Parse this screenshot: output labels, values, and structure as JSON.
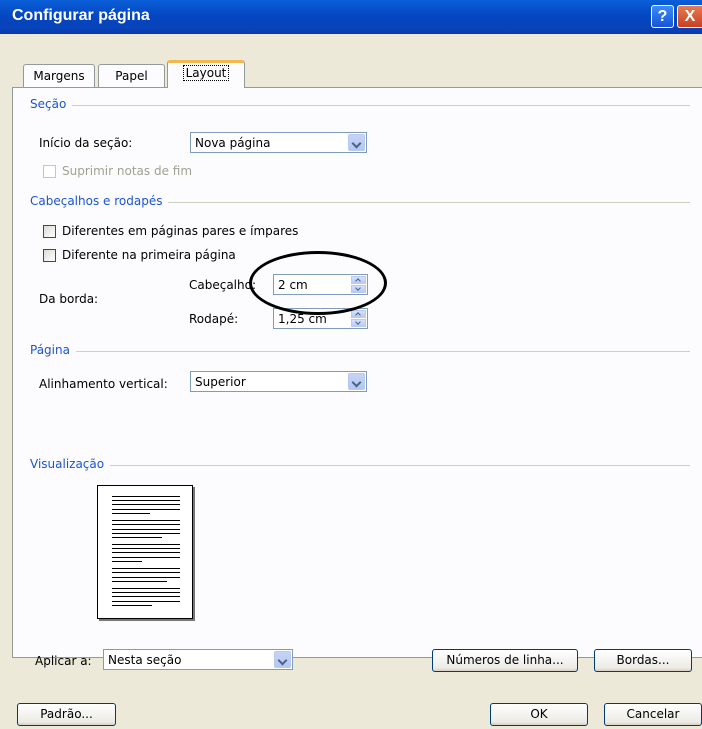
{
  "window": {
    "title": "Configurar página"
  },
  "titlebar": {
    "help": "?",
    "close": "X"
  },
  "tabs": [
    "Margens",
    "Papel",
    "Layout"
  ],
  "secao": {
    "heading": "Seção",
    "inicio_label": "Início da seção:",
    "inicio_value": "Nova página",
    "suprimir_label": "Suprimir notas de fim"
  },
  "cabecalhos": {
    "heading": "Cabeçalhos e rodapés",
    "pares_impares": "Diferentes em páginas pares e ímpares",
    "primeira_pagina": "Diferente na primeira página",
    "da_borda": "Da borda:",
    "cabecalho_label": "Cabeçalho:",
    "cabecalho_value": "2 cm",
    "rodape_label": "Rodapé:",
    "rodape_value": "1,25 cm"
  },
  "pagina": {
    "heading": "Página",
    "alinhamento_label": "Alinhamento vertical:",
    "alinhamento_value": "Superior"
  },
  "visualizacao": {
    "heading": "Visualização"
  },
  "aplicar": {
    "label": "Aplicar a:",
    "value": "Nesta seção"
  },
  "buttons": {
    "numeros": "Números de linha...",
    "bordas": "Bordas...",
    "padrao": "Padrão...",
    "ok": "OK",
    "cancelar": "Cancelar"
  },
  "colors": {
    "title_bar": "#0447c2",
    "group_heading": "#1c54cf",
    "tab_highlight": "#f3b74f"
  }
}
